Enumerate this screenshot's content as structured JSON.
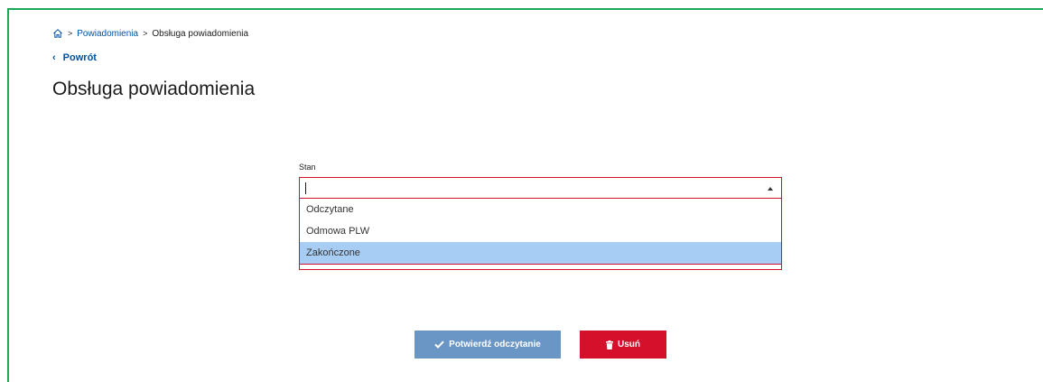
{
  "breadcrumb": {
    "home_icon": "home-icon",
    "items": [
      "Powiadomienia",
      "Obsługa powiadomienia"
    ],
    "separator": ">"
  },
  "back": {
    "label": "Powrót",
    "icon": "chevron-left-icon"
  },
  "page": {
    "title": "Obsługa powiadomienia"
  },
  "form": {
    "state": {
      "label": "Stan",
      "value": "",
      "options": [
        "Odczytane",
        "Odmowa PLW",
        "Zakończone"
      ],
      "highlighted_option": "Zakończone"
    }
  },
  "actions": {
    "confirm_label": "Potwierdź odczytanie",
    "confirm_icon": "check-icon",
    "delete_label": "Usuń",
    "delete_icon": "trash-icon"
  },
  "colors": {
    "link": "#0052a5",
    "error_border": "#d4102a",
    "confirm_button": "#6a96c6",
    "delete_button": "#d4102a",
    "option_highlight": "#a8cdf4",
    "frame": "#1ea85a"
  }
}
